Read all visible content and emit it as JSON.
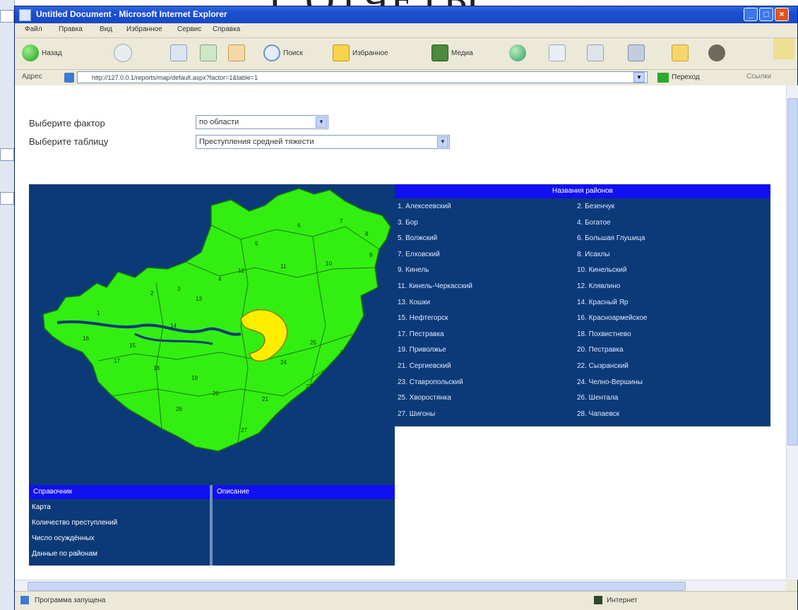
{
  "slide": {
    "title_fragment": "Г ОТЧЕТЫ"
  },
  "window": {
    "title": "Untitled Document - Microsoft Internet Explorer",
    "menu": [
      "Файл",
      "Правка",
      "Вид",
      "Избранное",
      "Сервис",
      "Справка"
    ],
    "toolbar": {
      "back": "Назад",
      "search": "Поиск",
      "favorites": "Избранное",
      "media": "Медиа"
    },
    "address": {
      "label": "Адрес",
      "url": "http://127.0.0.1/reports/map/default.aspx?factor=1&table=1",
      "go": "Переход",
      "links": "Ссылки"
    },
    "status": {
      "left": "Программа запущена",
      "right": "Интернет"
    }
  },
  "page": {
    "factor_label": "Выберите фактор",
    "factor_value": "по области",
    "table_label": "Выберите таблицу",
    "table_value": "Преступления средней тяжести"
  },
  "legend": {
    "header": "Названия районов",
    "col1": [
      "1. Алексеевский",
      "3. Бор",
      "5. Волжский",
      "7. Елховский",
      "9. Кинель",
      "11. Кинель-Черкасский",
      "13. Кошки",
      "15. Нефтегорск",
      "17. Пестравка",
      "19. Приволжье",
      "21. Сергиевский",
      "23. Ставропольский",
      "25. Хворостянка",
      "27. Шигоны"
    ],
    "col2": [
      "2. Безенчук",
      "4. Богатое",
      "6. Большая Глушица",
      "8. Исаклы",
      "10. Кинельский",
      "12. Клявлино",
      "14. Красный Яр",
      "16. Красноармейское",
      "18. Похвистнево",
      "20. Пестравка",
      "22. Сызранский",
      "24. Челно-Вершины",
      "26. Шентала",
      "28. Чапаевск"
    ]
  },
  "bottom_panel": {
    "left_head": "Справочник",
    "left_items": [
      "Карта",
      "Количество преступлений",
      "Число осуждённых",
      "Данные по районам"
    ],
    "right_head": "Описание"
  },
  "map": {
    "region_color": "#33ee11",
    "highlight_color": "#ffee00",
    "background": "#0c3a78",
    "numbers": [
      "1",
      "2",
      "3",
      "4",
      "5",
      "6",
      "7",
      "8",
      "9",
      "10",
      "11",
      "12",
      "13",
      "14",
      "15",
      "16",
      "17",
      "18",
      "19",
      "20",
      "21",
      "22",
      "23",
      "24",
      "25",
      "26",
      "27"
    ]
  },
  "colors": {
    "legend_head": "#1010f0",
    "title_bar": "#1c4fd0"
  }
}
